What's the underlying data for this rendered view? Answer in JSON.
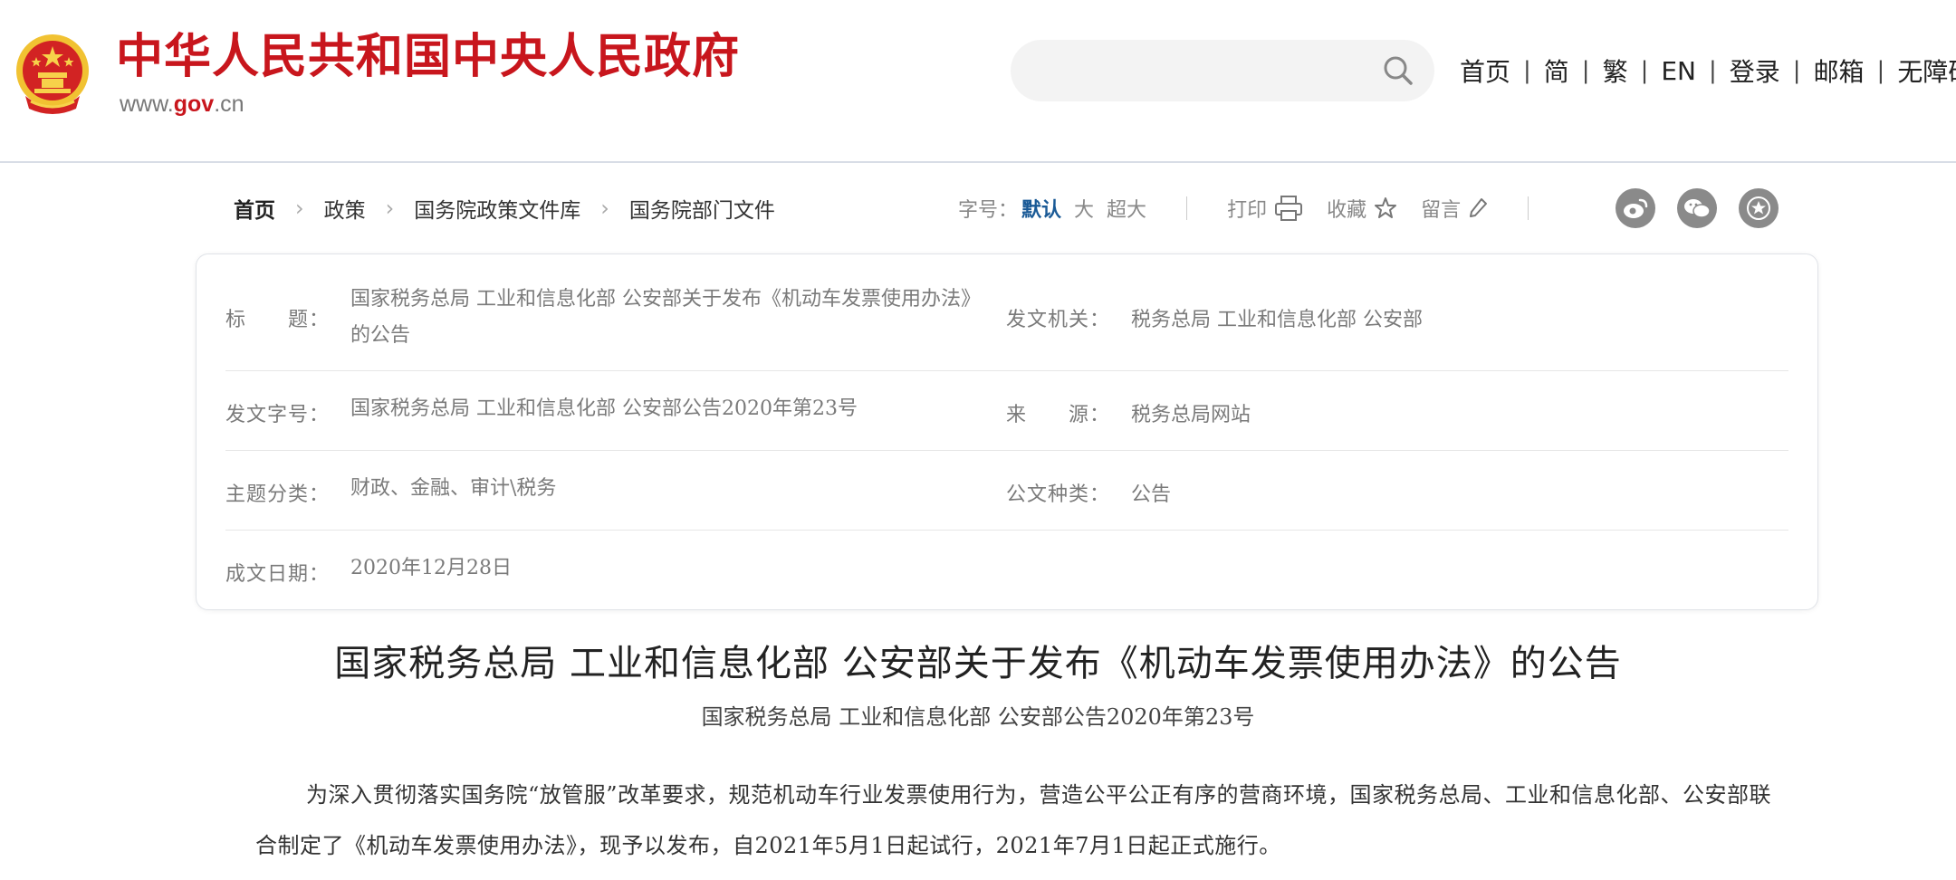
{
  "header": {
    "site_name": "中华人民共和国中央人民政府",
    "domain_prefix": "www.",
    "domain_gov": "gov",
    "domain_suffix": ".cn",
    "search_placeholder": "",
    "nav": [
      "首页",
      "简",
      "繁",
      "EN",
      "登录",
      "邮箱",
      "无障碍"
    ],
    "colors": {
      "brand_red": "#c8161d"
    }
  },
  "breadcrumb": [
    "首页",
    "政策",
    "国务院政策文件库",
    "国务院部门文件"
  ],
  "toolbar": {
    "font_label": "字号：",
    "font_default": "默认",
    "font_large": "大",
    "font_xlarge": "超大",
    "print_label": "打印",
    "favorite_label": "收藏",
    "comment_label": "留言",
    "share_icons": [
      "weibo-icon",
      "wechat-icon",
      "favorite-star-icon"
    ]
  },
  "info": {
    "title_label": "标　　题：",
    "title_value": "国家税务总局 工业和信息化部 公安部关于发布《机动车发票使用办法》的公告",
    "issuer_label": "发文机关：",
    "issuer_value": "税务总局 工业和信息化部 公安部",
    "docno_label": "发文字号：",
    "docno_value": "国家税务总局 工业和信息化部 公安部公告2020年第23号",
    "source_label": "来　　源：",
    "source_value": "税务总局网站",
    "topic_label": "主题分类：",
    "topic_value": "财政、金融、审计\\税务",
    "type_label": "公文种类：",
    "type_value": "公告",
    "date_label": "成文日期：",
    "date_value": "2020年12月28日"
  },
  "article": {
    "title": "国家税务总局 工业和信息化部 公安部关于发布《机动车发票使用办法》的公告",
    "docno": "国家税务总局 工业和信息化部 公安部公告2020年第23号",
    "paragraph": "为深入贯彻落实国务院“放管服”改革要求，规范机动车行业发票使用行为，营造公平公正有序的营商环境，国家税务总局、工业和信息化部、公安部联合制定了《机动车发票使用办法》，现予以发布，自2021年5月1日起试行，2021年7月1日起正式施行。"
  }
}
